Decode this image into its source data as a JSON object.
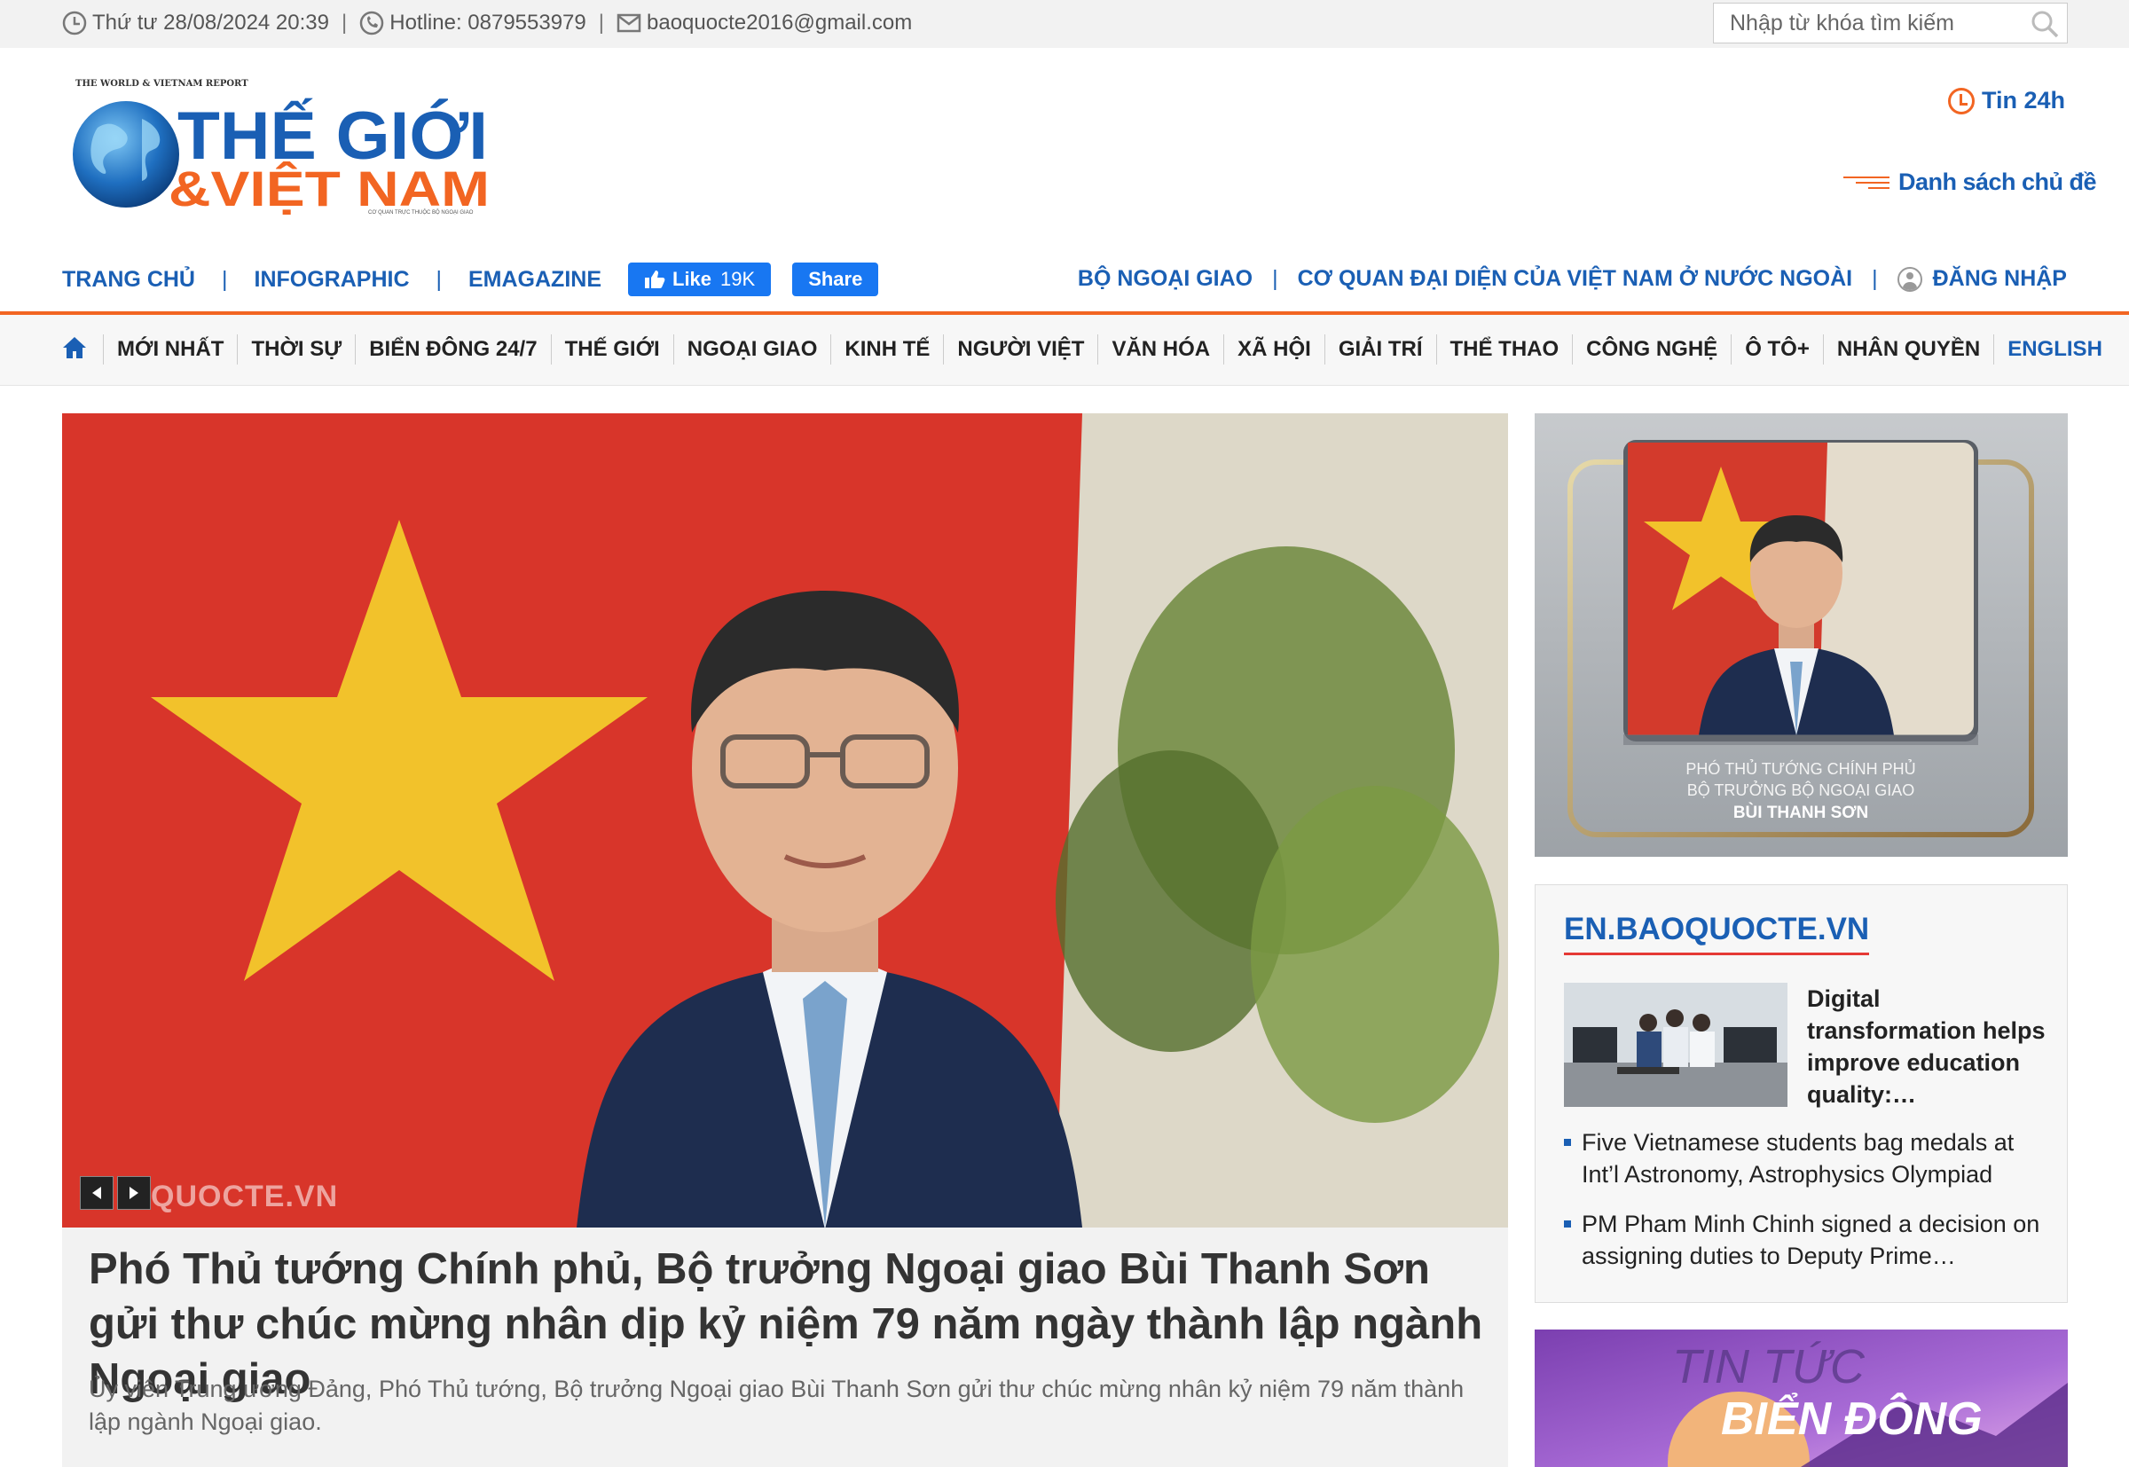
{
  "topbar": {
    "datetime": "Thứ tư 28/08/2024 20:39",
    "hotline": "Hotline: 0879553979",
    "email": "baoquocte2016@gmail.com",
    "search_placeholder": "Nhập từ khóa tìm kiếm"
  },
  "logo": {
    "tagline": "THE WORLD & VIETNAM REPORT",
    "line1": "THẾ GIỚI",
    "line2": "&VIỆT NAM",
    "subline": "CƠ QUAN TRỰC THUỘC BỘ NGOẠI GIAO"
  },
  "header": {
    "tin24": "Tin 24h",
    "topic_list": "Danh sách chủ đề"
  },
  "subnav": {
    "items": [
      "TRANG CHỦ",
      "INFOGRAPHIC",
      "EMAGAZINE"
    ],
    "fb_like": "Like",
    "fb_like_count": "19K",
    "fb_share": "Share"
  },
  "rightnav": {
    "items": [
      "BỘ NGOẠI GIAO",
      "CƠ QUAN ĐẠI DIỆN CỦA VIỆT NAM Ở NƯỚC NGOÀI"
    ],
    "login": "ĐĂNG NHẬP"
  },
  "mainnav": {
    "items": [
      "MỚI NHẤT",
      "THỜI SỰ",
      "BIỂN ĐÔNG 24/7",
      "THẾ GIỚI",
      "NGOẠI GIAO",
      "KINH TẾ",
      "NGƯỜI VIỆT",
      "VĂN HÓA",
      "XÃ HỘI",
      "GIẢI TRÍ",
      "THỂ THAO",
      "CÔNG NGHỆ",
      "Ô TÔ+",
      "NHÂN QUYỀN"
    ],
    "english": "ENGLISH"
  },
  "hero": {
    "watermark": "QUOCTE.VN",
    "title": "Phó Thủ tướng Chính phủ, Bộ trưởng Ngoại giao Bùi Thanh Sơn gửi thư chúc mừng nhân dịp kỷ niệm 79 năm ngày thành lập ngành Ngoại giao",
    "summary": "Ủy viên Trung ương Đảng, Phó Thủ tướng, Bộ trưởng Ngoại giao Bùi Thanh Sơn gửi thư chúc mừng nhân kỷ niệm 79 năm thành lập ngành Ngoại giao."
  },
  "portrait": {
    "caption1": "PHÓ THỦ TƯỚNG CHÍNH PHỦ",
    "caption2": "BỘ TRƯỞNG BỘ NGOẠI GIAO",
    "caption3": "BÙI THANH SƠN"
  },
  "en_box": {
    "heading": "EN.BAOQUOCTE.VN",
    "featured": "Digital transformation helps improve education quality:…",
    "items": [
      "Five Vietnamese students bag medals at Int’l Astronomy, Astrophysics Olympiad",
      "PM Pham Minh Chinh signed a decision on assigning duties to Deputy Prime…"
    ]
  },
  "banner": {
    "line1": "TIN TỨC",
    "line2": "BIỂN ĐÔNG"
  },
  "colors": {
    "brand_blue": "#1a5fb4",
    "accent_orange": "#f26522",
    "facebook": "#1877f2"
  }
}
